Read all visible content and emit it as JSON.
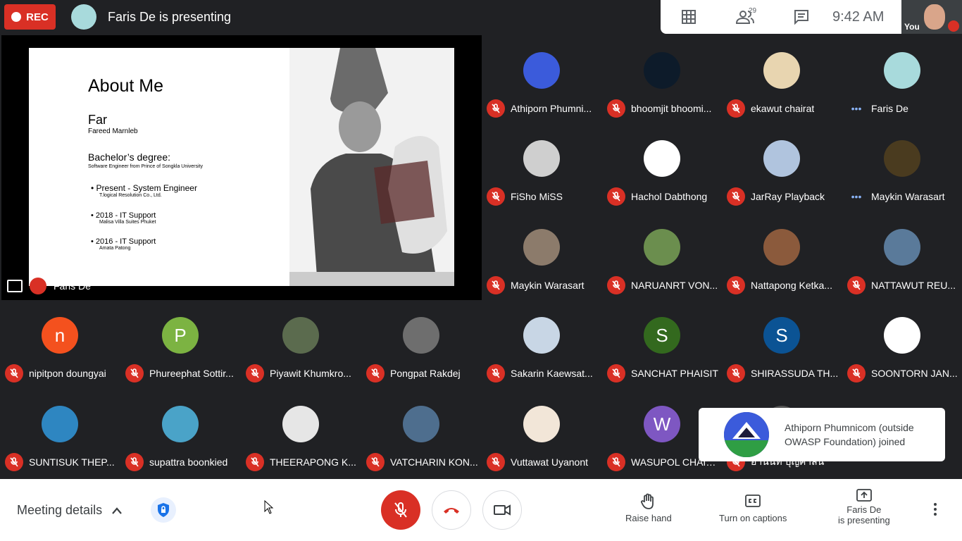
{
  "top": {
    "rec_label": "REC",
    "presenting_text": "Faris De is presenting",
    "people_count": "29",
    "time": "9:42 AM",
    "self_label": "You"
  },
  "slide": {
    "title": "About Me",
    "name": "Far",
    "fullname": "Fareed Marnleb",
    "degree": "Bachelor’s degree:",
    "degree_detail": "Software Engineer from Prince of Songkla University",
    "items": [
      {
        "title": "Present - System Engineer",
        "sub": "T.logical Resolution Co., Ltd."
      },
      {
        "title": "2018 - IT Support",
        "sub": "Malisa Villa Suites Phuket"
      },
      {
        "title": "2016 - IT Support",
        "sub": "Amata Patong"
      }
    ],
    "presenter_label": "Faris De"
  },
  "participants": [
    {
      "name": "Athiporn Phumni...",
      "initial": "",
      "color": "#3b5bdb",
      "muted": true
    },
    {
      "name": "bhoomjit bhoomi...",
      "initial": "",
      "color": "#0d1b2a",
      "muted": true
    },
    {
      "name": "ekawut chairat",
      "initial": "",
      "color": "#e8d5b0",
      "muted": true
    },
    {
      "name": "Faris De",
      "initial": "",
      "color": "#a8dadc",
      "muted": false
    },
    {
      "name": "FiSho MiSS",
      "initial": "",
      "color": "#cfcfcf",
      "muted": true
    },
    {
      "name": "Hachol Dabthong",
      "initial": "",
      "color": "#ffffff",
      "muted": true
    },
    {
      "name": "JarRay Playback",
      "initial": "",
      "color": "#b0c4de",
      "muted": true
    },
    {
      "name": "Maykin Warasart",
      "initial": "",
      "color": "#4a3b1f",
      "muted": false
    },
    {
      "name": "Maykin Warasart",
      "initial": "",
      "color": "#8c7b6b",
      "muted": true
    },
    {
      "name": "NARUANRT VON...",
      "initial": "",
      "color": "#6b8e4e",
      "muted": true
    },
    {
      "name": "Nattapong Ketka...",
      "initial": "",
      "color": "#8b5a3c",
      "muted": true
    },
    {
      "name": "NATTAWUT REU...",
      "initial": "",
      "color": "#5a7a9a",
      "muted": true
    },
    {
      "name": "nipitpon doungyai",
      "initial": "n",
      "color": "#f4511e",
      "muted": true
    },
    {
      "name": "Phureephat Sottir...",
      "initial": "P",
      "color": "#7cb342",
      "muted": true
    },
    {
      "name": "Piyawit Khumkro...",
      "initial": "",
      "color": "#5b6b4e",
      "muted": true
    },
    {
      "name": "Pongpat Rakdej",
      "initial": "",
      "color": "#6e6e6e",
      "muted": true
    },
    {
      "name": "Sakarin Kaewsat...",
      "initial": "",
      "color": "#c8d6e5",
      "muted": true
    },
    {
      "name": "SANCHAT PHAISIT",
      "initial": "S",
      "color": "#33691e",
      "muted": true
    },
    {
      "name": "SHIRASSUDA TH...",
      "initial": "S",
      "color": "#0b5394",
      "muted": true
    },
    {
      "name": "SOONTORN JAN...",
      "initial": "",
      "color": "#ffffff",
      "muted": true
    },
    {
      "name": "SUNTISUK THEP...",
      "initial": "",
      "color": "#2e86c1",
      "muted": true
    },
    {
      "name": "supattra boonkied",
      "initial": "",
      "color": "#4aa3c8",
      "muted": true
    },
    {
      "name": "THEERAPONG K...",
      "initial": "",
      "color": "#e6e6e6",
      "muted": true
    },
    {
      "name": "VATCHARIN KON...",
      "initial": "",
      "color": "#4e6e8e",
      "muted": true
    },
    {
      "name": "Vuttawat Uyanont",
      "initial": "",
      "color": "#f2e6d8",
      "muted": true
    },
    {
      "name": "WASUPOL CHAIS...",
      "initial": "W",
      "color": "#7e57c2",
      "muted": true
    },
    {
      "name": "อานนท์ บุญศาสนี",
      "initial": "",
      "color": "#555555",
      "muted": true
    }
  ],
  "toast": {
    "message": "Athiporn Phumnicom (outside OWASP Foundation) joined"
  },
  "bottom": {
    "meeting_details": "Meeting details",
    "raise_hand": "Raise hand",
    "captions": "Turn on captions",
    "presenting_line1": "Faris De",
    "presenting_line2": "is presenting"
  },
  "colors": {
    "background": "#202124",
    "danger": "#d93025",
    "accent": "#1a73e8"
  }
}
